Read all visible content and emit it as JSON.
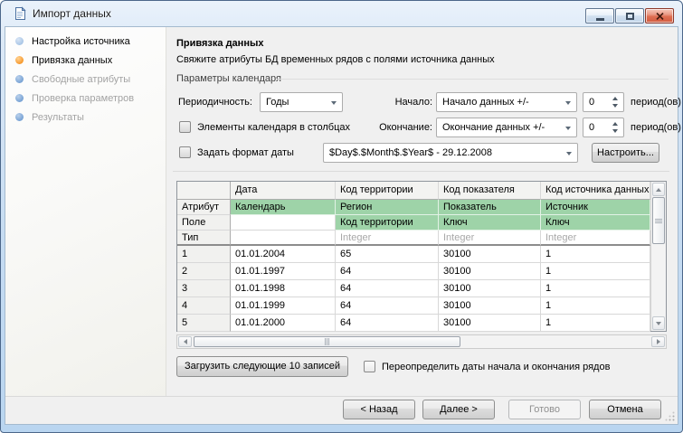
{
  "window": {
    "title": "Импорт данных",
    "controls": {
      "minimize": "minimize",
      "maximize": "maximize",
      "close": "close"
    }
  },
  "sidebar": {
    "steps": [
      {
        "label": "Настройка источника",
        "state": "done"
      },
      {
        "label": "Привязка данных",
        "state": "active"
      },
      {
        "label": "Свободные атрибуты",
        "state": "pending"
      },
      {
        "label": "Проверка параметров",
        "state": "pending"
      },
      {
        "label": "Результаты",
        "state": "pending"
      }
    ]
  },
  "main": {
    "heading": "Привязка данных",
    "subtitle": "Свяжите атрибуты БД временных рядов с полями источника данных",
    "calendar": {
      "group_label": "Параметры календаря",
      "periodicity_label": "Периодичность:",
      "periodicity_value": "Годы",
      "start_label": "Начало:",
      "start_value": "Начало данных +/-",
      "start_offset": "0",
      "end_label": "Окончание:",
      "end_value": "Окончание данных +/-",
      "end_offset": "0",
      "periods_suffix": "период(ов)",
      "columns_checkbox": "Элементы календаря в столбцах",
      "dateformat_checkbox": "Задать формат даты",
      "dateformat_value": "$Day$.$Month$.$Year$ - 29.12.2008",
      "configure_button": "Настроить..."
    },
    "table": {
      "columns": [
        "",
        "Дата",
        "Код территории",
        "Код показателя",
        "Код источника данных"
      ],
      "attr_row": {
        "header": "Атрибут",
        "cells": [
          "Календарь",
          "Регион",
          "Показатель",
          "Источник"
        ]
      },
      "field_row": {
        "header": "Поле",
        "cells": [
          "",
          "Код территории",
          "Ключ",
          "Ключ"
        ]
      },
      "type_row": {
        "header": "Тип",
        "cells": [
          "",
          "Integer",
          "Integer",
          "Integer"
        ]
      },
      "rows": [
        {
          "n": "1",
          "cells": [
            "01.01.2004",
            "65",
            "30100",
            "1"
          ]
        },
        {
          "n": "2",
          "cells": [
            "01.01.1997",
            "64",
            "30100",
            "1"
          ]
        },
        {
          "n": "3",
          "cells": [
            "01.01.1998",
            "64",
            "30100",
            "1"
          ]
        },
        {
          "n": "4",
          "cells": [
            "01.01.1999",
            "64",
            "30100",
            "1"
          ]
        },
        {
          "n": "5",
          "cells": [
            "01.01.2000",
            "64",
            "30100",
            "1"
          ]
        }
      ]
    },
    "load_button": "Загрузить следующие 10 записей",
    "override_checkbox": "Переопределить даты начала и окончания рядов"
  },
  "footer": {
    "back": "< Назад",
    "next": "Далее >",
    "finish": "Готово",
    "cancel": "Отмена"
  },
  "colors": {
    "mapping_highlight_green": "#9ED3A8",
    "active_step_orange": "#F79A2E",
    "pending_step_blue": "#79A3D5",
    "aero_border_blue": "#B9D5F0"
  },
  "icons": {
    "window_icon": "document",
    "minimize": "–",
    "maximize": "□",
    "close": "✕",
    "combo_arrow": "▼",
    "spin_up": "▲",
    "spin_down": "▼",
    "scroll_left": "◀",
    "scroll_right": "▶",
    "scroll_up": "▲",
    "scroll_down": "▼"
  }
}
